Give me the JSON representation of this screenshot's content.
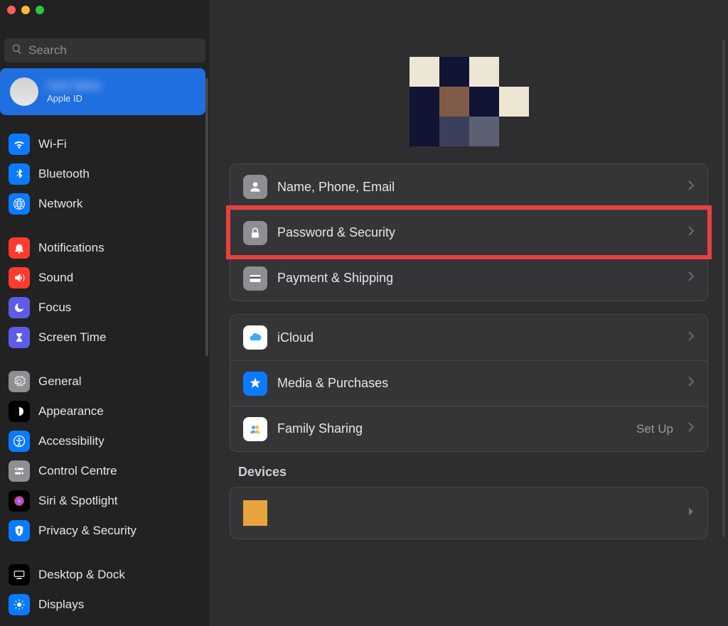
{
  "search": {
    "placeholder": "Search"
  },
  "account": {
    "name_hidden": "User Name",
    "sub": "Apple ID"
  },
  "sidebar": {
    "groups": [
      [
        {
          "id": "wifi",
          "label": "Wi-Fi",
          "color": "#0a7aff"
        },
        {
          "id": "bluetooth",
          "label": "Bluetooth",
          "color": "#0a7aff"
        },
        {
          "id": "network",
          "label": "Network",
          "color": "#0a7aff"
        }
      ],
      [
        {
          "id": "notifications",
          "label": "Notifications",
          "color": "#ff3b30"
        },
        {
          "id": "sound",
          "label": "Sound",
          "color": "#ff3b30"
        },
        {
          "id": "focus",
          "label": "Focus",
          "color": "#5e5ce6"
        },
        {
          "id": "screentime",
          "label": "Screen Time",
          "color": "#5e5ce6"
        }
      ],
      [
        {
          "id": "general",
          "label": "General",
          "color": "#8e8e93"
        },
        {
          "id": "appearance",
          "label": "Appearance",
          "color": "#000000"
        },
        {
          "id": "accessibility",
          "label": "Accessibility",
          "color": "#0a7aff"
        },
        {
          "id": "controlcentre",
          "label": "Control Centre",
          "color": "#8e8e93"
        },
        {
          "id": "siri",
          "label": "Siri & Spotlight",
          "color": "#000000"
        },
        {
          "id": "privacy",
          "label": "Privacy & Security",
          "color": "#0a7aff"
        }
      ],
      [
        {
          "id": "desktop",
          "label": "Desktop & Dock",
          "color": "#000000"
        },
        {
          "id": "displays",
          "label": "Displays",
          "color": "#0a7aff"
        }
      ]
    ]
  },
  "panels": [
    {
      "rows": [
        {
          "id": "name",
          "label": "Name, Phone, Email",
          "iconColor": "#8e8e93"
        },
        {
          "id": "password",
          "label": "Password & Security",
          "iconColor": "#8e8e93",
          "highlighted": true
        },
        {
          "id": "payment",
          "label": "Payment & Shipping",
          "iconColor": "#8e8e93"
        }
      ]
    },
    {
      "rows": [
        {
          "id": "icloud",
          "label": "iCloud",
          "iconColor": "#ffffff"
        },
        {
          "id": "media",
          "label": "Media & Purchases",
          "iconColor": "#0a7aff"
        },
        {
          "id": "family",
          "label": "Family Sharing",
          "iconColor": "#ffffff",
          "meta": "Set Up"
        }
      ]
    }
  ],
  "devices": {
    "title": "Devices"
  },
  "avatar_pixels": [
    "#ede6d4",
    "#121433",
    "#ede6d4",
    "transparent",
    "#121433",
    "#805c48",
    "#121433",
    "#ede6d4",
    "#121433",
    "#3a3f5a",
    "#5c6073",
    "transparent"
  ]
}
